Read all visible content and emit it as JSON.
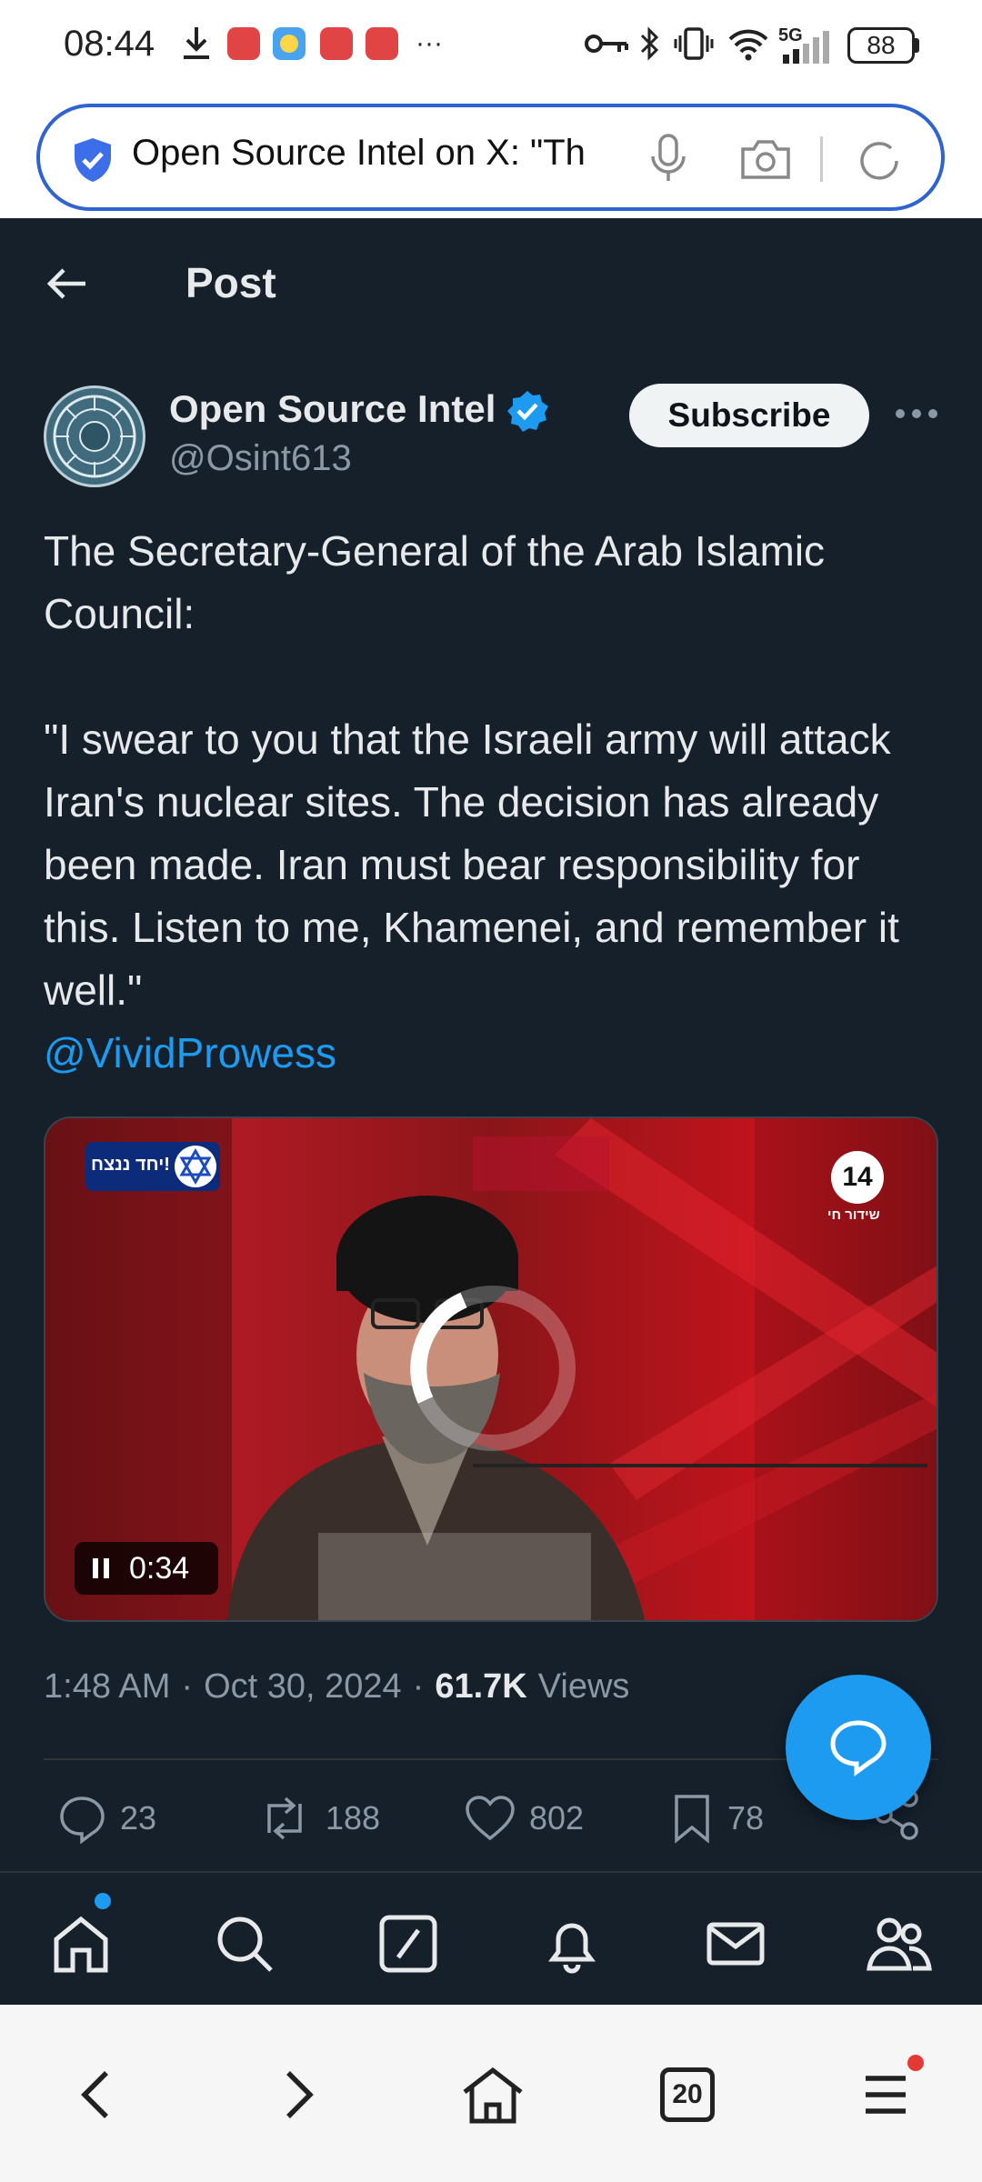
{
  "status_bar": {
    "time": "08:44",
    "network": "5G",
    "battery": "88",
    "overflow": "···"
  },
  "browser": {
    "url_text": "Open Source Intel on X: \"Th",
    "tab_count": "20",
    "accent_color": "#2f63d0"
  },
  "header": {
    "title": "Post"
  },
  "author": {
    "name": "Open Source Intel",
    "handle": "@Osint613",
    "subscribe_label": "Subscribe"
  },
  "tweet": {
    "paragraph1": "The Secretary-General of the Arab Islamic Council:",
    "paragraph2": "\"I swear to you that the Israeli army will attack Iran's nuclear sites. The decision has already been made. Iran must bear responsibility for this. Listen to me, Khamenei, and remember it well.\"",
    "mention": "@VividProwess"
  },
  "video": {
    "time": "0:34",
    "channel_number": "14",
    "channel_subtitle": "שידור חי",
    "banner_text": "יחד ננצח!",
    "playback_fraction": 0.3
  },
  "meta": {
    "time": "1:48 AM",
    "separator": "·",
    "date": "Oct 30, 2024",
    "views_count": "61.7K",
    "views_label": "Views"
  },
  "stats": {
    "replies": "23",
    "reposts": "188",
    "likes": "802",
    "bookmarks": "78"
  },
  "colors": {
    "x_background": "#15202b",
    "x_blue": "#1d9bf0",
    "text_primary": "#e7e9ea",
    "text_secondary": "#8b98a5"
  }
}
